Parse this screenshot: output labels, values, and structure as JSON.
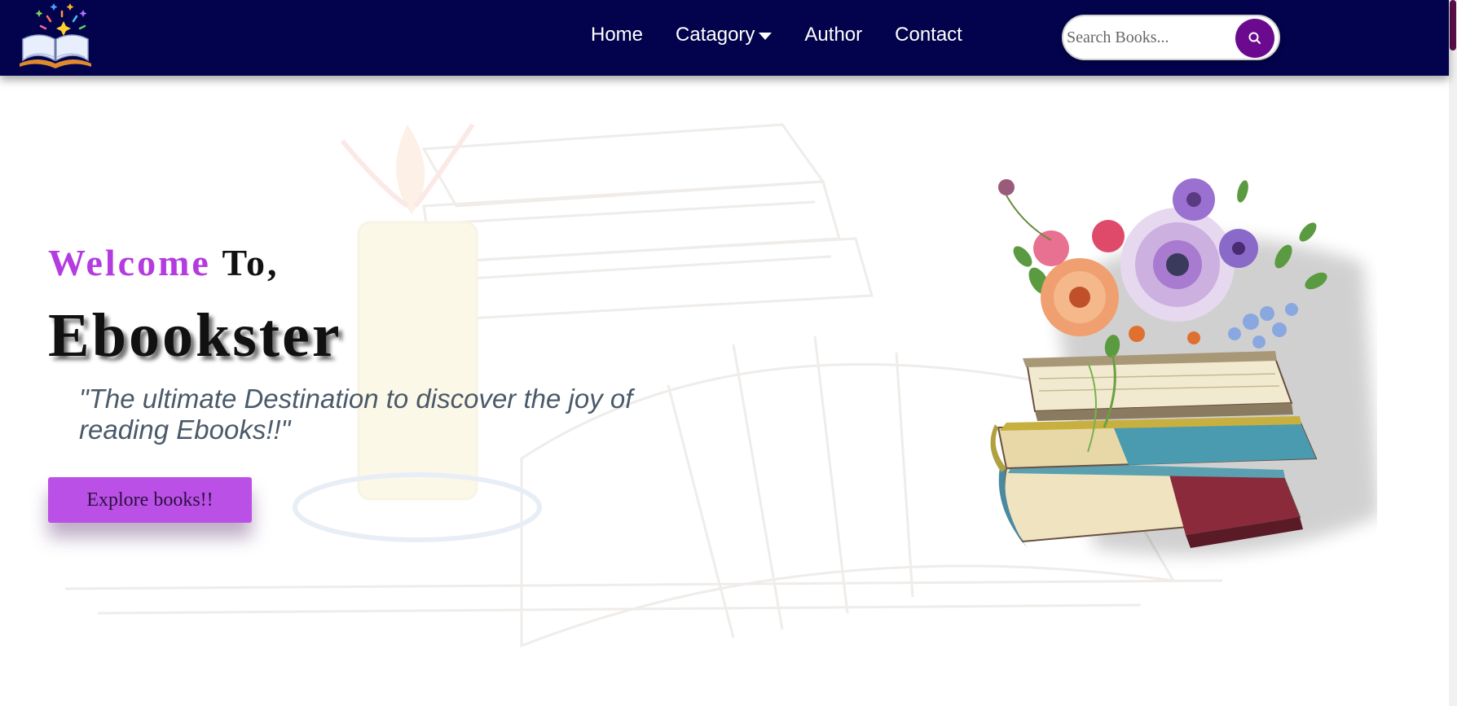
{
  "nav": {
    "links": [
      {
        "label": "Home"
      },
      {
        "label": "Catagory"
      },
      {
        "label": "Author"
      },
      {
        "label": "Contact"
      }
    ],
    "search_placeholder": "Search Books..."
  },
  "hero": {
    "welcome_word": "Welcome",
    "welcome_to": "To,",
    "brand": "Ebookster",
    "tagline": "\"The ultimate Destination to discover the joy of reading Ebooks!!\"",
    "cta_label": "Explore books!!"
  },
  "icons": {
    "logo": "open-book-with-sparkles",
    "search": "search-icon",
    "dropdown": "caret-down-icon"
  },
  "colors": {
    "navbar_bg": "#03034d",
    "accent_purple": "#b43be0",
    "button_purple": "#bb50e6",
    "search_button": "#6c0a8f",
    "tagline_color": "#4a5a6a"
  }
}
